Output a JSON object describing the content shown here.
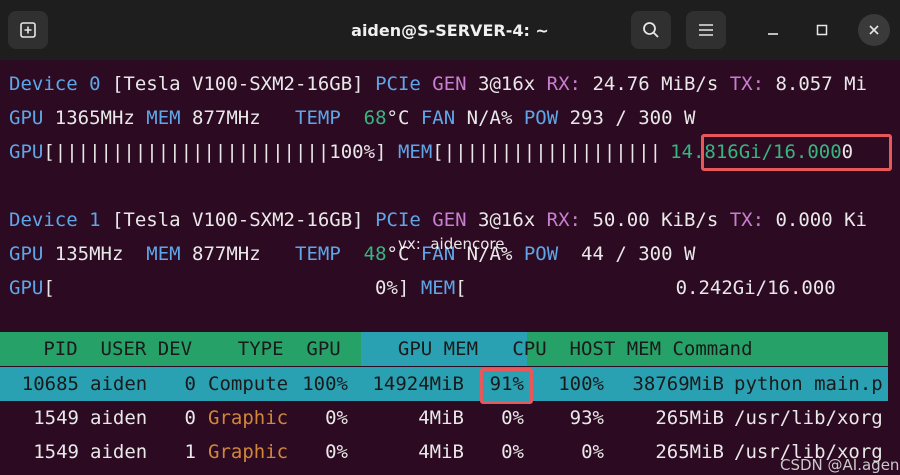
{
  "window": {
    "title": "aiden@S-SERVER-4: ~",
    "new_tab_icon": "new-tab-icon",
    "search_icon": "search-icon",
    "menu_icon": "hamburger-menu-icon",
    "minimize_icon": "minimize-icon",
    "maximize_icon": "maximize-icon",
    "close_icon": "close-icon"
  },
  "devices": [
    {
      "line1": {
        "device": "Device 0",
        "model": " [Tesla V100-SXM2-16GB] ",
        "pcie": "PCIe",
        "gen_label": " GEN",
        "gen_val": " 3@16x",
        "rx_label": " RX:",
        "rx_val": " 24.76 MiB/s",
        "tx_label": " TX:",
        "tx_val": " 8.057 Mi"
      },
      "line2": {
        "gpu_label": "GPU",
        "gpu_clock": " 1365MHz",
        "mem_label": " MEM",
        "mem_clock": " 877MHz  ",
        "temp_label": " TEMP",
        "temp_val": "  68",
        "temp_unit": "°C",
        "fan_label": " FAN",
        "fan_val": " N/A%",
        "pow_label": " POW",
        "pow_val": " 293 / 300 W"
      },
      "line3": {
        "gpu_bar_label": "GPU",
        "gpu_bar": "[||||||||||||||||||||||||100%]",
        "mem_bar_label": " MEM",
        "mem_bar_open": "[",
        "mem_bar": "|||||||||||||||||||",
        "mem_bar_val": "14.816Gi/16.000",
        "mem_bar_tail": "0"
      },
      "gpu_util": 100,
      "mem_used_gi": 14.816,
      "mem_total_gi": 16.0
    },
    {
      "line1": {
        "device": "Device 1",
        "model": " [Tesla V100-SXM2-16GB] ",
        "pcie": "PCIe",
        "gen_label": " GEN",
        "gen_val": " 3@16x",
        "rx_label": " RX:",
        "rx_val": " 50.00 KiB/s",
        "tx_label": " TX:",
        "tx_val": " 0.000 Ki"
      },
      "line2": {
        "gpu_label": "GPU",
        "gpu_clock": " 135MHz ",
        "mem_label": " MEM",
        "mem_clock": " 877MHz  ",
        "temp_label": " TEMP",
        "temp_val": "  48",
        "temp_unit": "°C",
        "fan_label": " FAN",
        "fan_val": " N/A%",
        "pow_label": " POW",
        "pow_val": "  44 / 300 W"
      },
      "line3": {
        "gpu_bar_label": "GPU",
        "gpu_bar": "[                            0%]",
        "mem_bar_label": " MEM",
        "mem_bar_open": "[",
        "mem_bar": "",
        "mem_bar_val": "0.242Gi/16.000",
        "mem_bar_tail": ""
      },
      "gpu_util": 0,
      "mem_used_gi": 0.242,
      "mem_total_gi": 16.0
    }
  ],
  "processes": {
    "header_left": "   PID  USER DEV    TYPE  GPU",
    "header_mid": "     GPU MEM",
    "header_right": "   CPU  HOST MEM Command",
    "rows": [
      {
        "pid": "10685",
        "user": "aiden",
        "dev": "0",
        "type": "Compute",
        "gpu": "100%",
        "gpu_mem": "14924MiB",
        "mem_pct": "91%",
        "cpu": "100%",
        "host_mem": "38769MiB",
        "command": "python main.p"
      },
      {
        "pid": "1549",
        "user": "aiden",
        "dev": "0",
        "type": "Graphic",
        "gpu": "0%",
        "gpu_mem": "4MiB",
        "mem_pct": "0%",
        "cpu": "93%",
        "host_mem": "265MiB",
        "command": "/usr/lib/xorg"
      },
      {
        "pid": "1549",
        "user": "aiden",
        "dev": "1",
        "type": "Graphic",
        "gpu": "0%",
        "gpu_mem": "4MiB",
        "mem_pct": "0%",
        "cpu": "0%",
        "host_mem": "265MiB",
        "command": "/usr/lib/xorg"
      }
    ]
  },
  "watermarks": {
    "center": "vx:  aidencore",
    "corner": "CSDN @AI.agen"
  },
  "colors": {
    "terminal_bg": "#2c0a22",
    "label_blue": "#5fa6e8",
    "label_purple": "#c87fd1",
    "temp_green": "#36b67e",
    "graphic_orange": "#d0873a",
    "header_teal": "#2aa1b3",
    "header_green": "#26a269",
    "highlight_red": "#e8585a"
  }
}
